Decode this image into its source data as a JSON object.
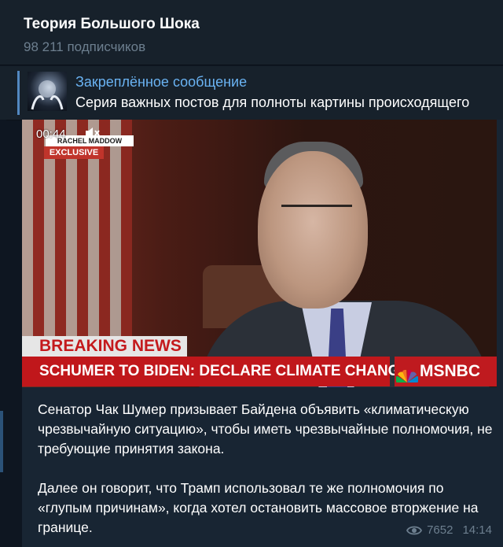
{
  "header": {
    "channel_name": "Теория Большого Шока",
    "subscribers": "98 211 подписчиков"
  },
  "pinned": {
    "title": "Закреплённое сообщение",
    "text": "Серия важных постов для полноты картины происходящего"
  },
  "video": {
    "timecode": "00:44",
    "show_badge": "RACHEL MADDOW SHOW",
    "exclusive": "EXCLUSIVE",
    "breaking": "BREAKING NEWS",
    "ticker": "SCHUMER TO BIDEN: DECLARE CLIMATE CHANGE AN EMERGENCY",
    "network": "MSNBC"
  },
  "message": {
    "paragraph1": "Сенатор Чак Шумер призывает Байдена объявить «климатическую чрезвычайную ситуацию», чтобы иметь чрезвычайные полномочия, не требующие принятия закона.",
    "paragraph2": "Далее он говорит, что Трамп использовал те же полномочия по «глупым причинам», когда хотел остановить массовое вторжение на границе.",
    "views": "7652",
    "time": "14:14"
  },
  "icons": {
    "volume": "volume-muted-icon",
    "eye": "eye-icon",
    "network_logo": "peacock-icon"
  },
  "colors": {
    "background": "#0e1621",
    "panel": "#17212b",
    "bubble": "#182533",
    "accent": "#6ab3f3",
    "muted": "#6d7f8f",
    "breaking_red": "#c0171b"
  }
}
